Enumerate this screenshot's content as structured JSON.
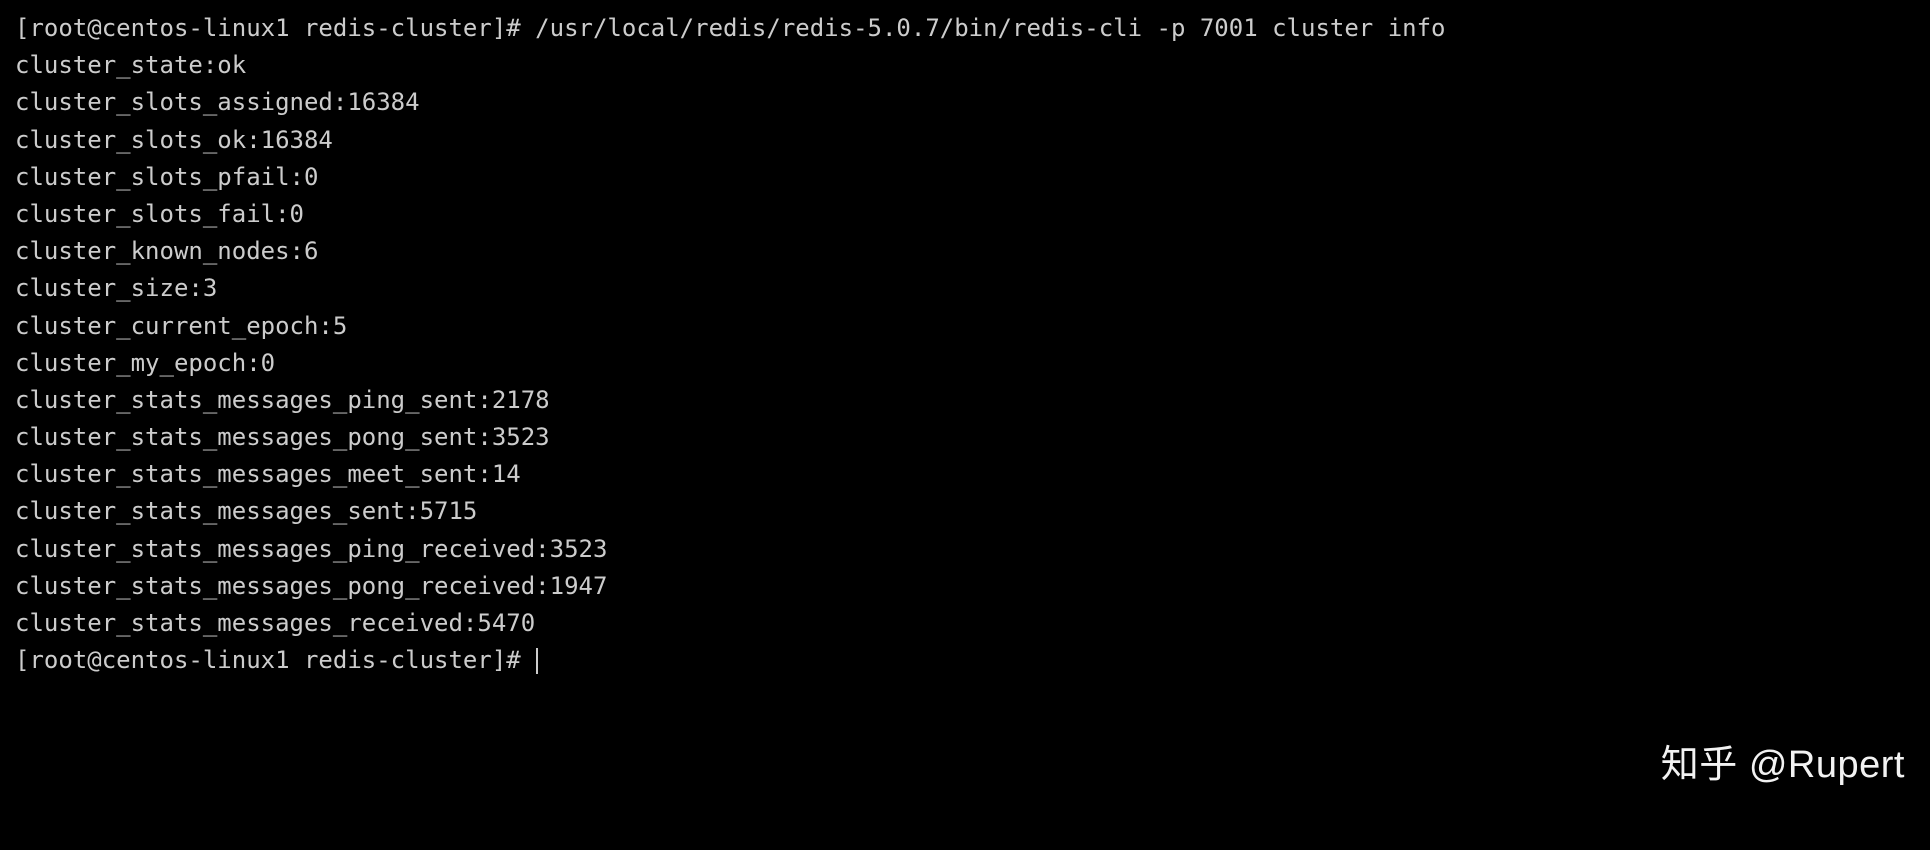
{
  "prompt": {
    "user_host": "[root@centos-linux1 redis-cluster]#",
    "command": " /usr/local/redis/redis-5.0.7/bin/redis-cli -p 7001 cluster info"
  },
  "output_lines": [
    "cluster_state:ok",
    "cluster_slots_assigned:16384",
    "cluster_slots_ok:16384",
    "cluster_slots_pfail:0",
    "cluster_slots_fail:0",
    "cluster_known_nodes:6",
    "cluster_size:3",
    "cluster_current_epoch:5",
    "cluster_my_epoch:0",
    "cluster_stats_messages_ping_sent:2178",
    "cluster_stats_messages_pong_sent:3523",
    "cluster_stats_messages_meet_sent:14",
    "cluster_stats_messages_sent:5715",
    "cluster_stats_messages_ping_received:3523",
    "cluster_stats_messages_pong_received:1947",
    "cluster_stats_messages_received:5470"
  ],
  "prompt_end": "[root@centos-linux1 redis-cluster]# ",
  "watermark": "知乎 @Rupert"
}
